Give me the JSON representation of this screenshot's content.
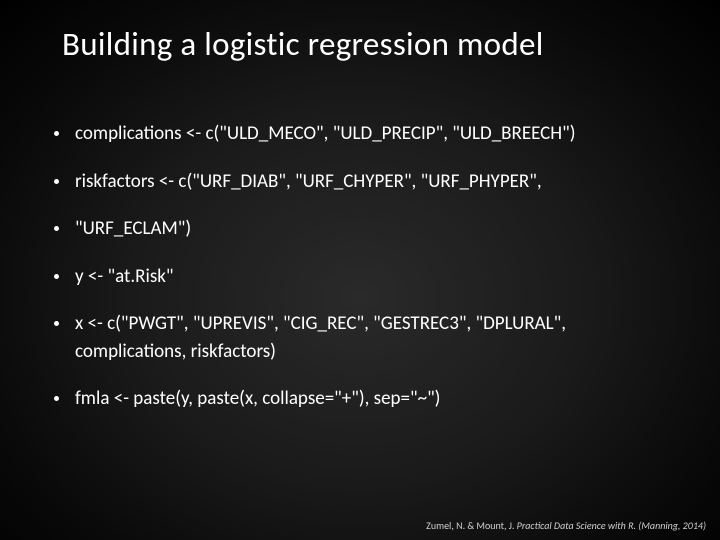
{
  "title": "Building a logistic regression model",
  "bullets": [
    {
      "text": "complications <- c(\"ULD_MECO\", \"ULD_PRECIP\", \"ULD_BREECH\")"
    },
    {
      "text": "riskfactors <- c(\"URF_DIAB\", \"URF_CHYPER\", \"URF_PHYPER\","
    },
    {
      "text": "\"URF_ECLAM\")"
    },
    {
      "text": "y <- \"at.Risk\""
    },
    {
      "text": "x <- c(\"PWGT\", \"UPREVIS\", \"CIG_REC\", \"GESTREC3\", \"DPLURAL\", complications, riskfactors)"
    },
    {
      "text": "fmla <- paste(y, paste(x, collapse=\"+\"), sep=\"~\")"
    }
  ],
  "citation": {
    "authors": "Zumel, N. & Mount, J. ",
    "title": "Practical Data Science with R.",
    "pub": " (Manning, 2014)"
  }
}
